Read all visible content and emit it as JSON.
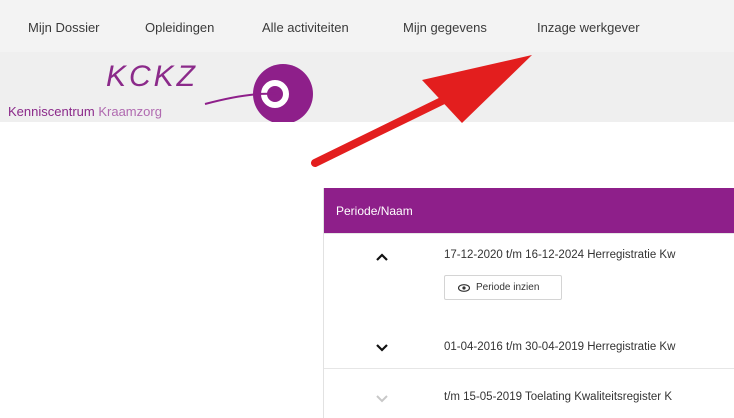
{
  "nav": {
    "items": [
      {
        "label": "Mijn Dossier"
      },
      {
        "label": "Opleidingen"
      },
      {
        "label": "Alle activiteiten"
      },
      {
        "label": "Mijn gegevens"
      },
      {
        "label": "Inzage werkgever"
      }
    ]
  },
  "logo": {
    "text": "KCKZ",
    "subtitle_a": "Kenniscentrum",
    "subtitle_b": "Kraamzorg",
    "color": "#8e1f8a"
  },
  "annotation": {
    "arrow_color": "#e31e1e"
  },
  "table": {
    "header": "Periode/Naam",
    "header_color": "#8e1f8a",
    "rows": [
      {
        "text": "17-12-2020 t/m 16-12-2024 Herregistratie Kw",
        "icon": "chevron-up-icon"
      },
      {
        "text": "01-04-2016 t/m 30-04-2019 Herregistratie Kw",
        "icon": "chevron-down-icon"
      },
      {
        "text": "t/m 15-05-2019 Toelating Kwaliteitsregister K",
        "icon": "chevron-down-icon"
      }
    ],
    "view_button": {
      "label": "Periode inzien",
      "icon": "eye-icon"
    }
  }
}
